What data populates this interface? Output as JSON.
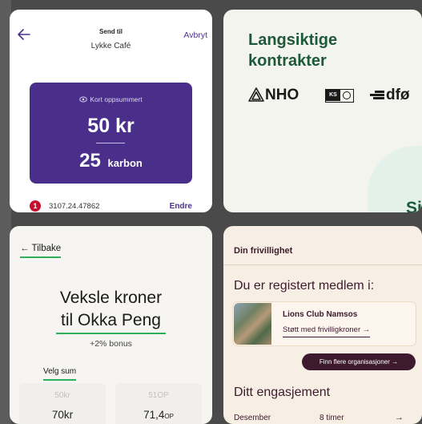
{
  "send_card": {
    "send_to_label": "Send til",
    "recipient": "Lykke Café",
    "cancel_label": "Avbryt",
    "summary_label": "Kort oppsummert",
    "amount_kr": "50 kr",
    "amount_carbon_value": "25",
    "amount_carbon_unit": "karbon",
    "account_badge": "1",
    "account_number": "3107.24.47862",
    "change_label": "Endre",
    "accent_color": "#4a2f8a"
  },
  "contracts_card": {
    "title": "Langsiktige kontrakter",
    "logo_nho": "NHO",
    "logo_ks": "KS",
    "logo_dfo": "dfø",
    "partial_text": "Si",
    "accent_color": "#1d5a3a"
  },
  "exchange_card": {
    "back_label": "← Tilbake",
    "title_line1": "Veksle kroner",
    "title_line2": "til Okka Peng",
    "bonus": "+2% bonus",
    "choose_sum": "Velg sum",
    "tiles": [
      {
        "top": "50kr",
        "bottom_value": "70kr",
        "bottom_unit": ""
      },
      {
        "top": "51OP",
        "bottom_value": "71,4",
        "bottom_unit": "OP"
      }
    ],
    "accent_color": "#2fae5c"
  },
  "volunteer_card": {
    "header": "Din frivillighet",
    "registered": "Du er registert medlem i:",
    "club_name": "Lions Club Namsos",
    "club_support": "Støtt med frivilligkroner →",
    "find_more": "Finn flere organisasjoner →",
    "engagement_title": "Ditt engasjement",
    "engagement_month": "Desember",
    "engagement_hours": "8 timer",
    "engagement_arrow": "→",
    "accent_color": "#3d1a2e"
  }
}
